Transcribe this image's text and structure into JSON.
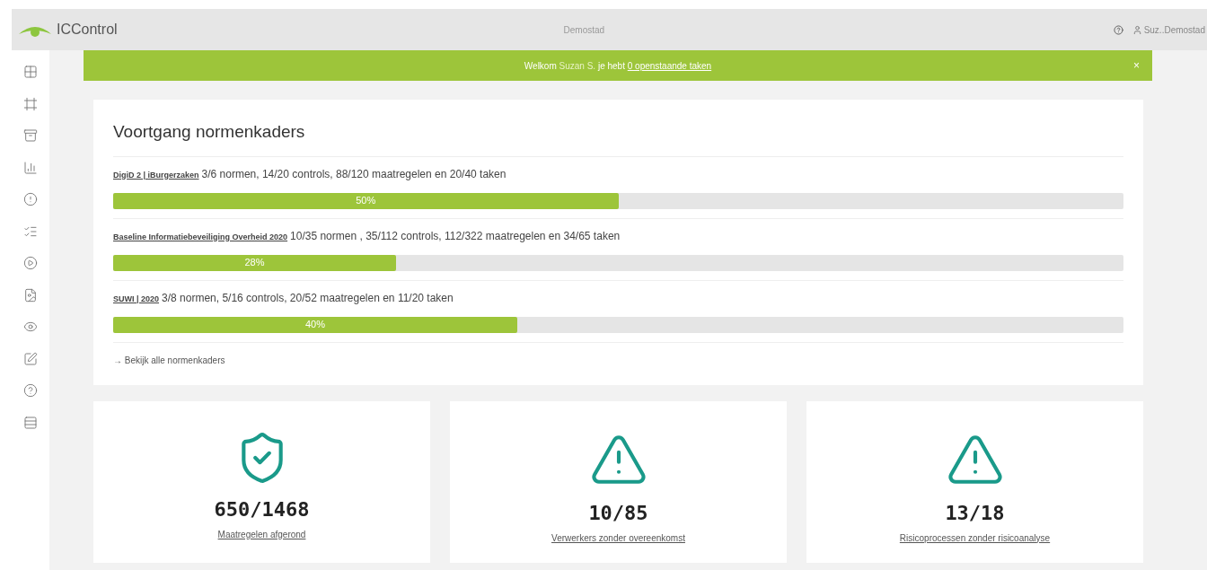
{
  "header": {
    "brand": "ICControl",
    "organization": "Demostad",
    "user": "Suz..Demostad"
  },
  "banner": {
    "greeting": "Welkom",
    "name": "Suzan S.",
    "middle": "je hebt",
    "link": "0 openstaande taken",
    "close": "×"
  },
  "progress": {
    "title": "Voortgang normenkaders",
    "items": [
      {
        "name": "DigiD 2 | iBurgerzaken",
        "summary": "3/6 normen, 14/20 controls, 88/120 maatregelen en 20/40 taken",
        "level": 0.5,
        "reading": "50%"
      },
      {
        "name": "Baseline Informatiebeveiliging Overheid 2020",
        "summary": "10/35 normen , 35/112 controls, 112/322 maatregelen en 34/65 taken",
        "level": 0.28,
        "reading": "28%"
      },
      {
        "name": "SUWI | 2020",
        "summary": "3/8 normen, 5/16 controls, 20/52 maatregelen en 11/20 taken",
        "level": 0.4,
        "reading": "40%"
      }
    ],
    "more_link": "→ Bekijk alle normenkaders"
  },
  "stats": [
    {
      "kind": "shield",
      "value": "650/1468",
      "label": "Maatregelen afgerond"
    },
    {
      "kind": "warning",
      "value": "10/85",
      "label": "Verwerkers zonder overeenkomst"
    },
    {
      "kind": "warning",
      "value": "13/18",
      "label": "Risicoprocessen zonder risicoanalyse"
    }
  ]
}
